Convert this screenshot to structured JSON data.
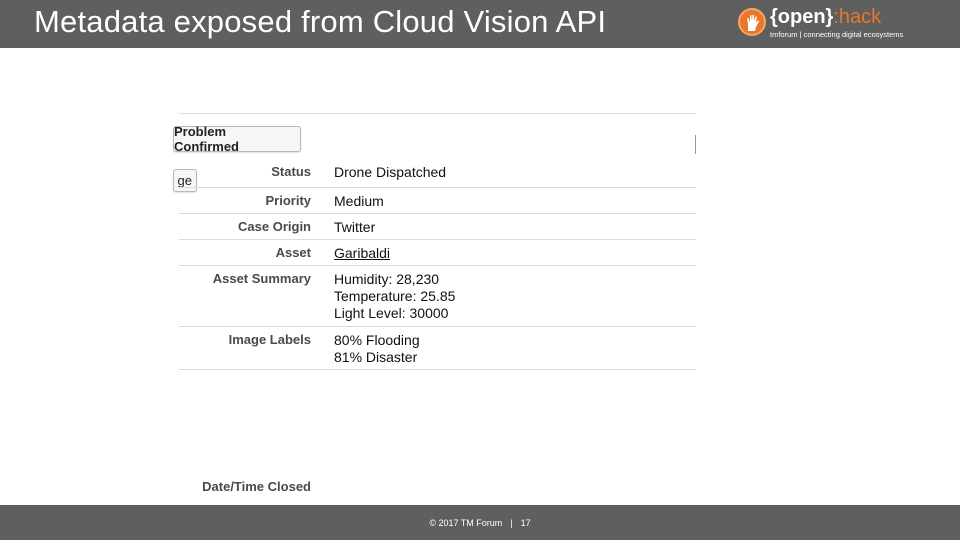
{
  "slide": {
    "title": "Metadata exposed from Cloud Vision API"
  },
  "logo": {
    "open": "{open}",
    "hack": ":hack",
    "tagline": "tmforum | connecting digital ecosystems"
  },
  "record": {
    "primary_button": "Problem Confirmed",
    "secondary_button_fragment": "ge",
    "fields": [
      {
        "label": "Status",
        "values": [
          "Drone Dispatched"
        ]
      },
      {
        "label": "Priority",
        "values": [
          "Medium"
        ]
      },
      {
        "label": "Case Origin",
        "values": [
          "Twitter"
        ]
      },
      {
        "label": "Asset",
        "values": [
          "Garibaldi"
        ]
      },
      {
        "label": "Asset Summary",
        "values": [
          "Humidity: 28,230",
          "Temperature: 25.85",
          "Light Level: 30000"
        ]
      },
      {
        "label": "Image Labels",
        "values": [
          "80% Flooding",
          "81% Disaster"
        ]
      }
    ],
    "date_closed_label": "Date/Time Closed"
  },
  "footer": {
    "copyright": "© 2017  TM  Forum",
    "separator": "|",
    "page_number": "17"
  },
  "colors": {
    "bar": "#5f5f5f",
    "accent": "#e8762b"
  }
}
